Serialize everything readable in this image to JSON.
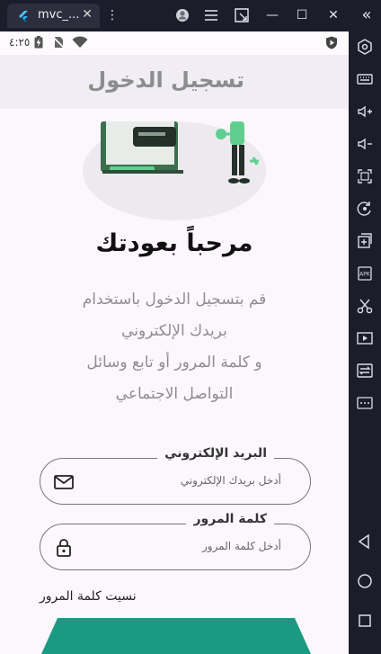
{
  "emulator": {
    "tab_title": "mvc_...",
    "tab_close": "✕",
    "menu_dots": "⋮",
    "minimize": "—",
    "maximize": "☐",
    "close": "✕",
    "collapse": "«"
  },
  "status_bar": {
    "time": "٤:٢٥"
  },
  "app_bar": {
    "title": "تسجيل الدخول"
  },
  "welcome": {
    "title": "مرحباً بعودتك",
    "description_lines": [
      "قم بتسجيل الدخول باستخدام",
      "بريدك الإلكتروني",
      "و كلمة المرور أو تابع وسائل",
      "التواصل الاجتماعي"
    ]
  },
  "email_field": {
    "label": "البريد الإلكتروني",
    "placeholder": "أدخل بريدك الإلكتروني"
  },
  "password_field": {
    "label": "كلمة المرور",
    "placeholder": "أدخل كلمة المرور"
  },
  "forgot_password": "نسيت كلمة المرور",
  "colors": {
    "accent": "#1b9a83",
    "illustration_green": "#5fcf8f"
  }
}
